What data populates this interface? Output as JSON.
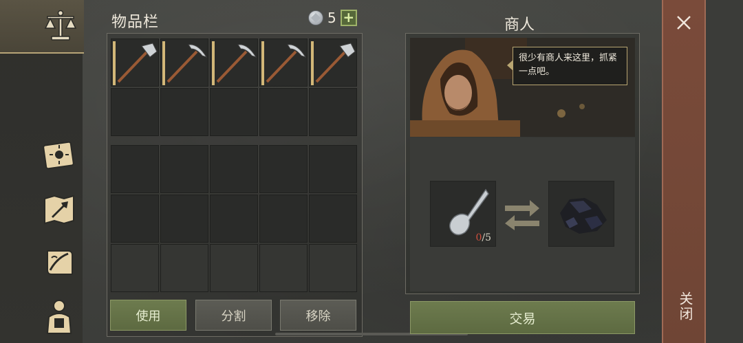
{
  "inventory": {
    "title": "物品栏",
    "currency_count": "5",
    "plus": "+",
    "tools": [
      "axe",
      "pickaxe",
      "pickaxe",
      "pickaxe",
      "axe"
    ],
    "buttons": {
      "use": "使用",
      "split": "分割",
      "remove": "移除"
    }
  },
  "merchant": {
    "title": "商人",
    "speech": "很少有商人来这里，抓紧一点吧。",
    "offer": {
      "have": "0",
      "sep": "/",
      "need": "5",
      "item_icon": "spoon-icon"
    },
    "reward": {
      "item_icon": "coal-icon"
    },
    "trade_label": "交易"
  },
  "close": {
    "label": "关闭",
    "icon": "close-icon"
  },
  "sidebar": {
    "icons": [
      "balance-scale-icon",
      "sun-book-icon",
      "map-arrow-icon",
      "scroll-quill-icon",
      "character-backpack-icon"
    ]
  },
  "colors": {
    "accent_green": "#6d7b4e",
    "close_panel": "#7a4b3a",
    "gold": "#d2b778"
  }
}
